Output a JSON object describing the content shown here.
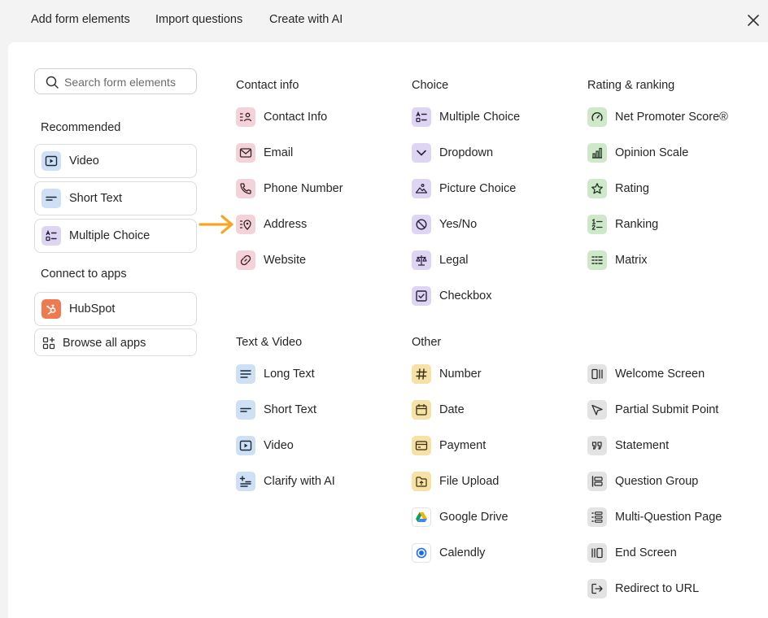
{
  "top_tabs": {
    "add": "Add form elements",
    "import": "Import questions",
    "ai": "Create with AI"
  },
  "search": {
    "placeholder": "Search form elements"
  },
  "sidebar": {
    "recommended_title": "Recommended",
    "recommended": [
      {
        "label": "Video",
        "icon": "video-icon"
      },
      {
        "label": "Short Text",
        "icon": "short-text-icon"
      },
      {
        "label": "Multiple Choice",
        "icon": "multiple-choice-icon"
      }
    ],
    "connect_title": "Connect to apps",
    "hubspot": "HubSpot",
    "browse": "Browse all apps"
  },
  "sections": {
    "contact": {
      "title": "Contact info",
      "items": [
        "Contact Info",
        "Email",
        "Phone Number",
        "Address",
        "Website"
      ]
    },
    "choice": {
      "title": "Choice",
      "items": [
        "Multiple Choice",
        "Dropdown",
        "Picture Choice",
        "Yes/No",
        "Legal",
        "Checkbox"
      ]
    },
    "rating": {
      "title": "Rating & ranking",
      "items": [
        "Net Promoter Score®",
        "Opinion Scale",
        "Rating",
        "Ranking",
        "Matrix"
      ]
    },
    "text_video": {
      "title": "Text & Video",
      "items": [
        "Long Text",
        "Short Text",
        "Video",
        "Clarify with AI"
      ]
    },
    "other": {
      "title": "Other",
      "items": [
        "Number",
        "Date",
        "Payment",
        "File Upload",
        "Google Drive",
        "Calendly"
      ]
    },
    "other2": {
      "items": [
        "Welcome Screen",
        "Partial Submit Point",
        "Statement",
        "Question Group",
        "Multi-Question Page",
        "End Screen",
        "Redirect to URL"
      ]
    }
  },
  "colors": {
    "contact": "#f3d3da",
    "choice": "#ddd5f2",
    "rating": "#cfe8c9",
    "text": "#cfe0f4",
    "other": "#f6e1a6",
    "structure": "#e3e3e3",
    "arrow": "#f5a623",
    "hubspot": "#ef7a4f"
  }
}
